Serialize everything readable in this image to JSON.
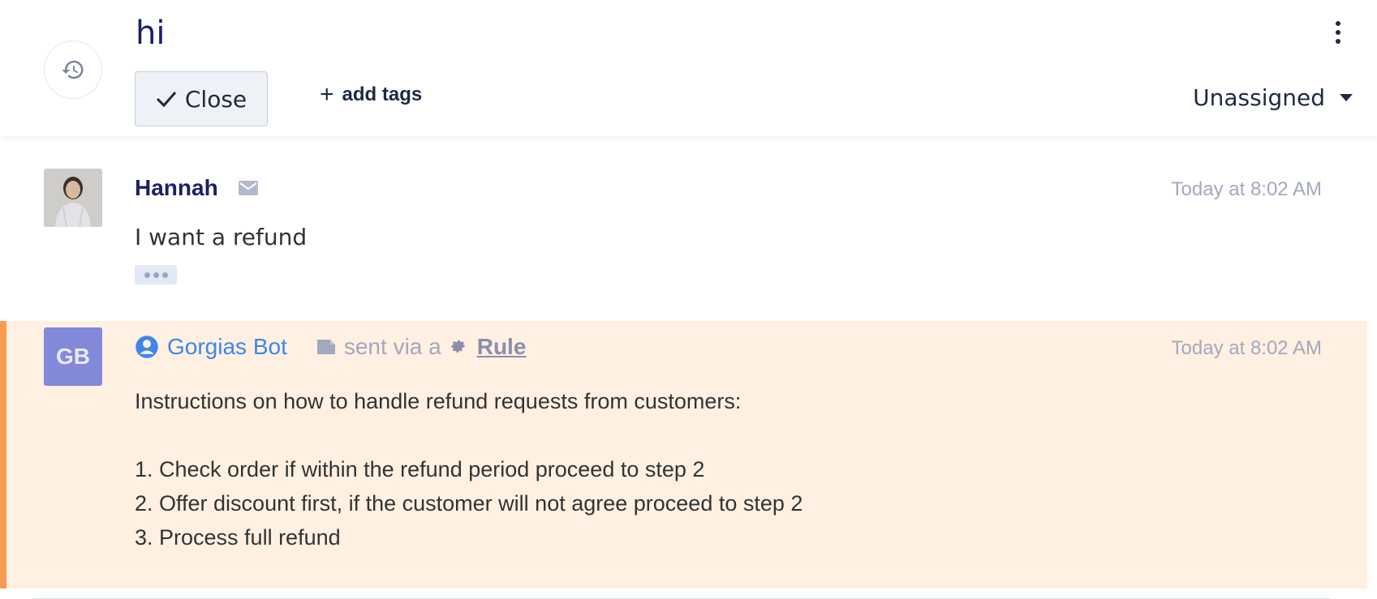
{
  "ticket": {
    "title": "hi",
    "close_label": "Close",
    "add_tags_label": "add tags",
    "assignee": "Unassigned"
  },
  "messages": [
    {
      "sender": "Hannah",
      "time": "Today at 8:02 AM",
      "body": "I want a refund",
      "channel_icon": "mail-icon"
    },
    {
      "sender": "Gorgias Bot",
      "avatar_initials": "GB",
      "via_text": "sent via a",
      "rule_label": "Rule",
      "time": "Today at 8:02 AM",
      "lines": [
        "Instructions on how to handle refund requests from customers:",
        "",
        "1. Check order if within the refund period proceed to step 2",
        "2. Offer discount first, if the customer will not agree proceed to step 2",
        "3. Process full refund"
      ]
    }
  ],
  "colors": {
    "title": "#1b1f6b",
    "bot_name": "#3f86e8",
    "internal_note_bg": "#fff0e2",
    "internal_note_border": "#f79a52",
    "avatar_gb_bg": "#8189d8"
  }
}
